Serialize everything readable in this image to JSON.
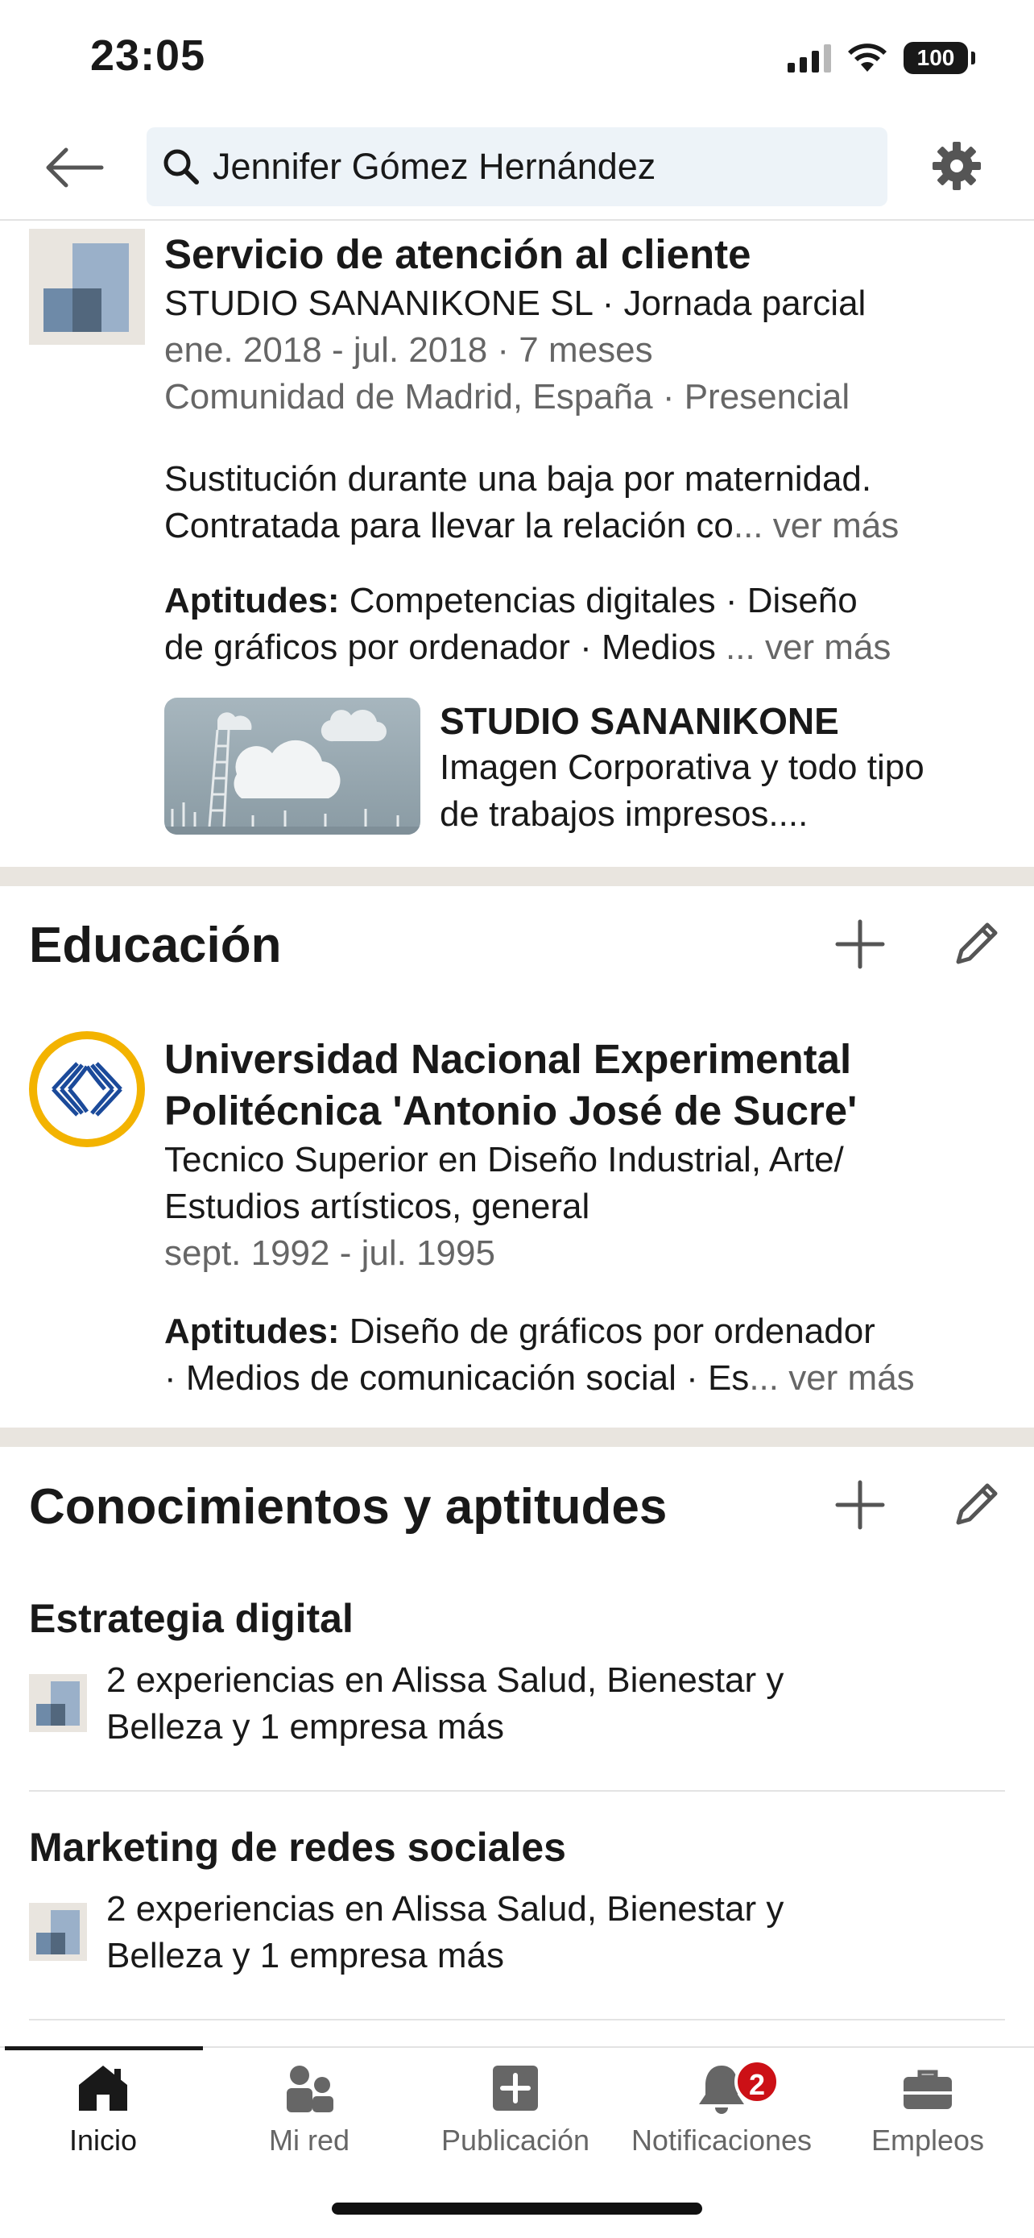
{
  "status_bar": {
    "time": "23:05",
    "battery": "100"
  },
  "search": {
    "query": "Jennifer Gómez Hernández"
  },
  "experience_item": {
    "title": "Servicio de atención al cliente",
    "company_line": "STUDIO SANANIKONE SL · Jornada parcial",
    "dates": "ene. 2018 - jul. 2018 · 7 meses",
    "location": "Comunidad de Madrid, España · Presencial",
    "description_line1": "Sustitución durante una baja por maternidad.",
    "description_line2": "Contratada para llevar la relación co",
    "description_more": "... ver más",
    "skills_label": "Aptitudes:",
    "skills_line1": " Competencias digitales · Diseño",
    "skills_line2": "de gráficos por ordenador · Medios ",
    "skills_more": "... ver más",
    "media": {
      "title": "STUDIO SANANIKONE",
      "line1": "Imagen Corporativa y todo tipo",
      "line2": "de trabajos impresos...."
    }
  },
  "education": {
    "section_title": "Educación",
    "school_line1": "Universidad Nacional Experimental",
    "school_line2": "Politécnica 'Antonio José de Sucre'",
    "degree_line1": "Tecnico Superior en Diseño Industrial, Arte/",
    "degree_line2": "Estudios artísticos, general",
    "dates": "sept. 1992 - jul. 1995",
    "skills_label": "Aptitudes:",
    "skills_line1": " Diseño de gráficos por ordenador",
    "skills_line2": "· Medios de comunicación social · Es",
    "skills_more": "... ver más"
  },
  "skills_section": {
    "section_title": "Conocimientos y aptitudes",
    "items": [
      {
        "name": "Estrategia digital",
        "line1": "2 experiencias en Alissa Salud, Bienestar y",
        "line2": "Belleza y 1 empresa más"
      },
      {
        "name": "Marketing de redes sociales",
        "line1": "2 experiencias en Alissa Salud, Bienestar y",
        "line2": "Belleza y 1 empresa más"
      }
    ]
  },
  "bottom_nav": {
    "items": [
      {
        "label": "Inicio",
        "icon": "home-icon"
      },
      {
        "label": "Mi red",
        "icon": "network-icon"
      },
      {
        "label": "Publicación",
        "icon": "post-icon"
      },
      {
        "label": "Notificaciones",
        "icon": "bell-icon",
        "badge": "2"
      },
      {
        "label": "Empleos",
        "icon": "briefcase-icon"
      }
    ]
  }
}
